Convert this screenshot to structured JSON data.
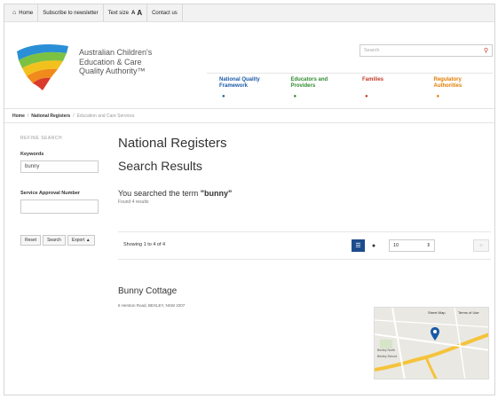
{
  "topbar": {
    "home": "Home",
    "subscribe": "Subscribe to newsletter",
    "text_size": "Text size",
    "text_a_small": "A",
    "text_a_large": "A",
    "contact": "Contact us"
  },
  "header": {
    "logo_lines": [
      "Australian Children's",
      "Education & Care",
      "Quality Authority™"
    ],
    "search_placeholder": "Search",
    "nav": [
      {
        "line1": "National Quality",
        "line2": "Framework",
        "color": "#1a5aa6"
      },
      {
        "line1": "Educators and",
        "line2": "Providers",
        "color": "#2f8a2f"
      },
      {
        "line1": "Families",
        "line2": "",
        "color": "#c0392b"
      },
      {
        "line1": "Regulatory",
        "line2": "Authorities",
        "color": "#e07b00"
      }
    ]
  },
  "breadcrumb": {
    "home": "Home",
    "national_registers": "National Registers",
    "current": "Education and Care Services"
  },
  "sidebar": {
    "title": "REFINE SEARCH",
    "keywords_label": "Keywords",
    "keywords_value": "bunny",
    "approval_label": "Service Approval Number",
    "approval_value": "",
    "buttons": [
      "Reset",
      "Search",
      "Export ▲"
    ]
  },
  "main": {
    "page_title": "National Registers",
    "subtitle": "Search Results",
    "searched_prefix": "You searched the term ",
    "searched_term": "\"bunny\"",
    "found_text": "Found 4 results",
    "showing_text": "Showing 1 to 4 of 4",
    "per_page_value": "10",
    "result_title": "Bunny Cottage",
    "result_address": "6 Herston Road, BEXLEY, NSW 2207",
    "map_labels": [
      "Bexley North",
      "Bexley School",
      "Street Map",
      "Terms of Use"
    ]
  },
  "colors": {
    "accent": "#1c4c8c",
    "marker": "#1a5aa6"
  }
}
